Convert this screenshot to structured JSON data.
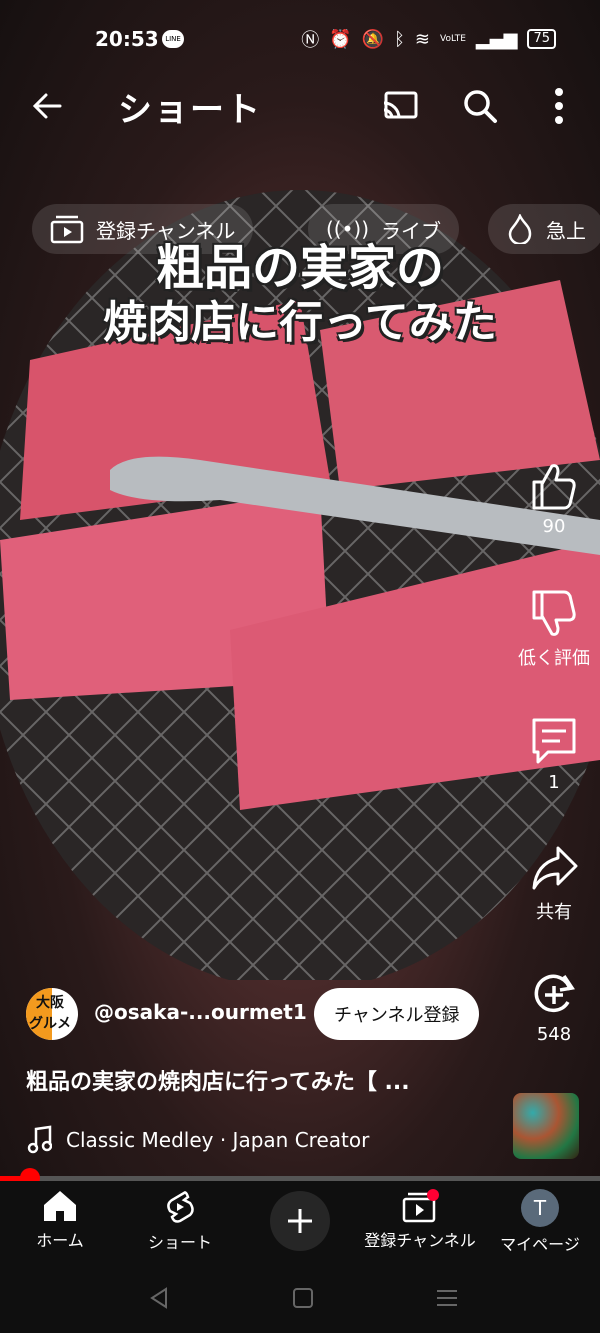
{
  "status_bar": {
    "time": "20:53",
    "line_badge": "LINE",
    "network": "VoLTE",
    "battery": "75"
  },
  "topbar": {
    "title": "ショート"
  },
  "chips": [
    {
      "label": "登録チャンネル",
      "icon": "subscriptions-icon"
    },
    {
      "label": "ライブ",
      "icon": "live-icon"
    },
    {
      "label": "急上",
      "icon": "trending-icon"
    }
  ],
  "video": {
    "overlay_line1": "粗品の実家の",
    "overlay_line2": "焼肉店に行ってみた"
  },
  "actions": {
    "like_count": "90",
    "dislike_label": "低く評価",
    "comment_count": "1",
    "share_label": "共有",
    "remix_count": "548"
  },
  "channel": {
    "avatar_text_top": "大阪",
    "avatar_text_bottom": "グルメ",
    "handle": "@osaka-...ourmet1",
    "subscribe_label": "チャンネル登録"
  },
  "video_title": "粗品の実家の焼肉店に行ってみた【 ...",
  "music": {
    "text": "Classic Medley · Japan Creator"
  },
  "progress": {
    "fraction": 0.05
  },
  "bottom_nav": [
    {
      "label": "ホーム",
      "icon": "home-icon"
    },
    {
      "label": "ショート",
      "icon": "shorts-icon"
    },
    {
      "label": "",
      "icon": "plus-icon"
    },
    {
      "label": "登録チャンネル",
      "icon": "subscriptions-icon"
    },
    {
      "label": "マイページ",
      "avatar_letter": "T"
    }
  ],
  "colors": {
    "accent": "#ff0000",
    "nav_bg": "#0f0f0f",
    "subscribe_bg": "#ffffff"
  }
}
